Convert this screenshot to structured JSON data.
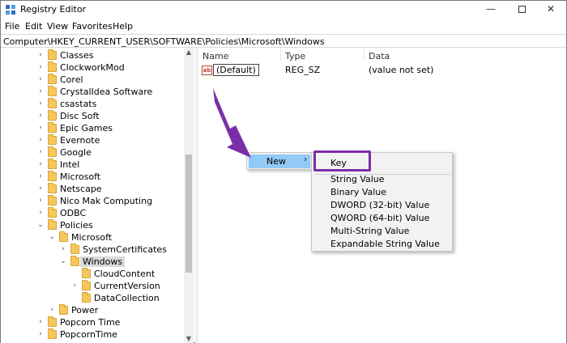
{
  "window": {
    "title": "Registry Editor",
    "minimize": "—",
    "close": "✕"
  },
  "menu": [
    "File",
    "Edit",
    "View",
    "Favorites",
    "Help"
  ],
  "address": "Computer\\HKEY_CURRENT_USER\\SOFTWARE\\Policies\\Microsoft\\Windows",
  "tree": [
    {
      "label": "Classes",
      "level": 0,
      "expander": "›"
    },
    {
      "label": "ClockworkMod",
      "level": 0,
      "expander": "›"
    },
    {
      "label": "Corel",
      "level": 0,
      "expander": "›"
    },
    {
      "label": "CrystalIdea Software",
      "level": 0,
      "expander": "›"
    },
    {
      "label": "csastats",
      "level": 0,
      "expander": "›"
    },
    {
      "label": "Disc Soft",
      "level": 0,
      "expander": "›"
    },
    {
      "label": "Epic Games",
      "level": 0,
      "expander": "›"
    },
    {
      "label": "Evernote",
      "level": 0,
      "expander": "›"
    },
    {
      "label": "Google",
      "level": 0,
      "expander": "›"
    },
    {
      "label": "Intel",
      "level": 0,
      "expander": "›"
    },
    {
      "label": "Microsoft",
      "level": 0,
      "expander": "›"
    },
    {
      "label": "Netscape",
      "level": 0,
      "expander": "›"
    },
    {
      "label": "Nico Mak Computing",
      "level": 0,
      "expander": "›"
    },
    {
      "label": "ODBC",
      "level": 0,
      "expander": "›"
    },
    {
      "label": "Policies",
      "level": 0,
      "expander": "⌄"
    },
    {
      "label": "Microsoft",
      "level": 1,
      "expander": "⌄"
    },
    {
      "label": "SystemCertificates",
      "level": 2,
      "expander": "›"
    },
    {
      "label": "Windows",
      "level": 2,
      "expander": "⌄",
      "selected": true
    },
    {
      "label": "CloudContent",
      "level": 3,
      "expander": ""
    },
    {
      "label": "CurrentVersion",
      "level": 3,
      "expander": "›"
    },
    {
      "label": "DataCollection",
      "level": 3,
      "expander": ""
    },
    {
      "label": "Power",
      "level": 1,
      "expander": "›"
    },
    {
      "label": "Popcorn Time",
      "level": 0,
      "expander": "›"
    },
    {
      "label": "PopcornTime",
      "level": 0,
      "expander": "›"
    }
  ],
  "columns": {
    "name": "Name",
    "type": "Type",
    "data": "Data"
  },
  "values": [
    {
      "icon": "ab",
      "name": "(Default)",
      "type": "REG_SZ",
      "data": "(value not set)"
    }
  ],
  "context_menu": {
    "new_label": "New",
    "submenu": [
      "Key",
      "String Value",
      "Binary Value",
      "DWORD (32-bit) Value",
      "QWORD (64-bit) Value",
      "Multi-String Value",
      "Expandable String Value"
    ]
  },
  "colors": {
    "highlight": "#91c9f7",
    "annotation": "#7b2ea8",
    "folder": "#f6c75a"
  }
}
